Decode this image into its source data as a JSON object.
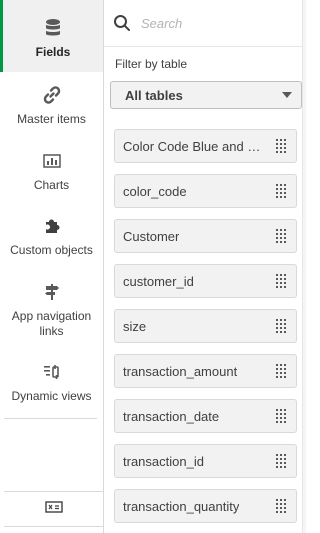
{
  "rail": {
    "items": [
      {
        "label": "Fields",
        "icon": "database-icon",
        "active": true
      },
      {
        "label": "Master items",
        "icon": "link-icon",
        "active": false
      },
      {
        "label": "Charts",
        "icon": "bar-chart-icon",
        "active": false
      },
      {
        "label": "Custom objects",
        "icon": "puzzle-icon",
        "active": false
      },
      {
        "label": "App navigation links",
        "icon": "signpost-icon",
        "active": false
      },
      {
        "label": "Dynamic views",
        "icon": "dynamic-view-icon",
        "active": false
      }
    ],
    "bottom_icon": "variable-icon"
  },
  "search": {
    "placeholder": "Search"
  },
  "filter": {
    "label": "Filter by table",
    "selected": "All tables"
  },
  "fields": [
    "Color Code Blue and Red",
    "color_code",
    "Customer",
    "customer_id",
    "size",
    "transaction_amount",
    "transaction_date",
    "transaction_id",
    "transaction_quantity"
  ],
  "colors": {
    "accent": "#009845",
    "item_bg": "#f2f2f2",
    "border": "#d9d9d9"
  }
}
